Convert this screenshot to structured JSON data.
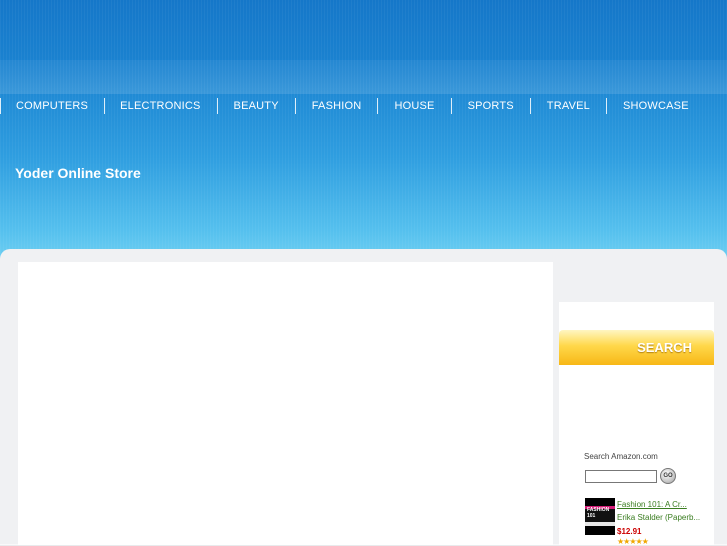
{
  "nav": {
    "items": [
      "COMPUTERS",
      "ELECTRONICS",
      "BEAUTY",
      "FASHION",
      "HOUSE",
      "SPORTS",
      "TRAVEL",
      "SHOWCASE"
    ]
  },
  "site": {
    "title": "Yoder Online Store"
  },
  "sidebar": {
    "search_heading": "SEARCH",
    "amazon_label": "Search Amazon.com",
    "go_label": "GO",
    "product": {
      "thumb_text": "FASHION 101",
      "title": "Fashion 101: A Cr...",
      "author": "Erika Stalder (Paperb...",
      "price": "$12.91",
      "stars": "★★★★★"
    }
  },
  "colors": {
    "header_top": "#1577c9",
    "header_bottom": "#6fd0f2",
    "search_heading": "#ffd84a",
    "product_link": "#3a7d20",
    "price": "#cc0000"
  }
}
